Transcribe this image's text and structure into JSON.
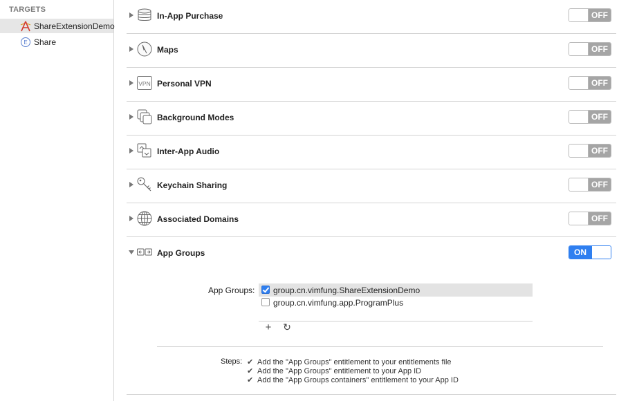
{
  "sidebar": {
    "header": "TARGETS",
    "targets": [
      {
        "label": "ShareExtensionDemo",
        "icon": "app-target-icon",
        "selected": true
      },
      {
        "label": "Share",
        "icon": "extension-icon",
        "selected": false
      }
    ]
  },
  "capabilities": [
    {
      "label": "In-App Purchase",
      "icon": "coin-stack-icon",
      "state": "OFF",
      "expanded": false
    },
    {
      "label": "Maps",
      "icon": "maps-compass-icon",
      "state": "OFF",
      "expanded": false
    },
    {
      "label": "Personal VPN",
      "icon": "vpn-icon",
      "icon_text": "VPN",
      "state": "OFF",
      "expanded": false
    },
    {
      "label": "Background Modes",
      "icon": "background-modes-icon",
      "state": "OFF",
      "expanded": false
    },
    {
      "label": "Inter-App Audio",
      "icon": "inter-app-audio-icon",
      "state": "OFF",
      "expanded": false
    },
    {
      "label": "Keychain Sharing",
      "icon": "key-icon",
      "state": "OFF",
      "expanded": false
    },
    {
      "label": "Associated Domains",
      "icon": "globe-icon",
      "state": "OFF",
      "expanded": false
    },
    {
      "label": "App Groups",
      "icon": "app-groups-icon",
      "state": "ON",
      "expanded": true
    }
  ],
  "app_groups": {
    "label": "App Groups:",
    "items": [
      {
        "id": "group.cn.vimfung.ShareExtensionDemo",
        "checked": true,
        "selected": true
      },
      {
        "id": "group.cn.vimfung.app.ProgramPlus",
        "checked": false,
        "selected": false
      }
    ],
    "add_symbol": "+",
    "refresh_symbol": "↻"
  },
  "steps": {
    "label": "Steps:",
    "check_symbol": "✔",
    "items": [
      "Add the \"App Groups\" entitlement to your entitlements file",
      "Add the \"App Groups\" entitlement to your App ID",
      "Add the \"App Groups containers\" entitlement to your App ID"
    ]
  },
  "colors": {
    "accent": "#2f7ff0",
    "toggle_off": "#a5a5a5",
    "selected_row": "#e6e6e6"
  }
}
